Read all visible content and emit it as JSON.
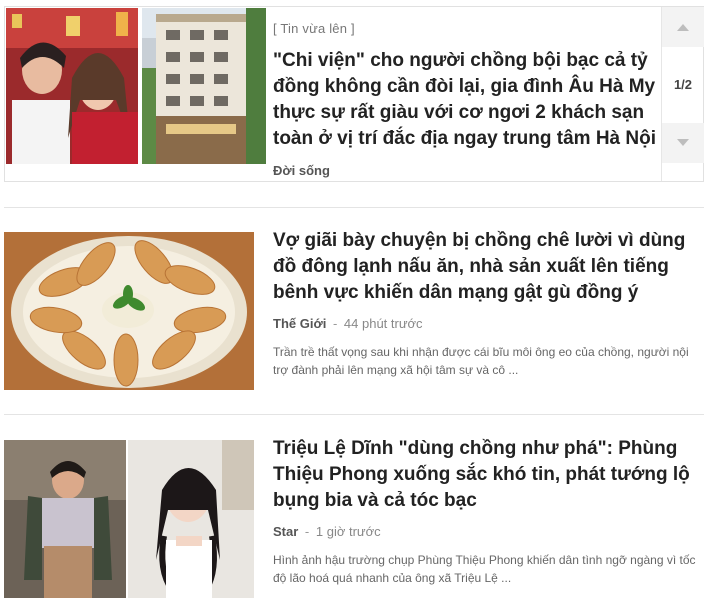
{
  "featured": {
    "tag": "[ Tin vừa lên ]",
    "title": "\"Chi viện\" cho người chồng bội bạc cả tỷ đồng không cần đòi lại, gia đình Âu Hà My thực sự rất giàu với cơ ngơi 2 khách sạn toàn ở vị trí đắc địa ngay trung tâm Hà Nội",
    "category": "Đời sống",
    "pager": "1/2",
    "image_icon": "couple-and-hotel-photo"
  },
  "articles": [
    {
      "title": "Vợ giãi bày chuyện bị chồng chê lười vì dùng đồ đông lạnh nấu ăn, nhà sản xuất lên tiếng bênh vực khiến dân mạng gật gù đồng ý",
      "category": "Thế Giới",
      "separator": "-",
      "time": "44 phút trước",
      "description": "Trần trề thất vọng sau khi nhận được cái bĩu môi ông eo của chồng, người nội trợ đành phải lên mạng xã hội tâm sự và cô ...",
      "image_icon": "dumplings-photo"
    },
    {
      "title": "Triệu Lệ Dĩnh \"dùng chồng như phá\": Phùng Thiệu Phong xuống sắc khó tin, phát tướng lộ bụng bia và cả tóc bạc",
      "category": "Star",
      "separator": "-",
      "time": "1 giờ trước",
      "description": "Hình ảnh hậu trường chụp Phùng Thiệu Phong khiến dân tình ngỡ ngàng vì tốc độ lão hoá quá nhanh của ông xã Triệu Lệ ...",
      "image_icon": "celebrity-photo"
    }
  ],
  "colors": {
    "border": "#e1e1e1",
    "pager_bg": "#f3f3f3",
    "title": "#222222",
    "meta": "#888888"
  }
}
